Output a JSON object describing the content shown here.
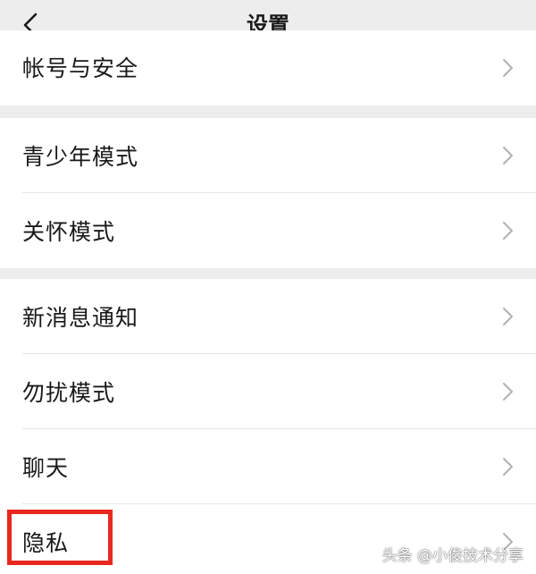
{
  "header": {
    "title": "设置"
  },
  "groups": [
    {
      "items": [
        {
          "label": "帐号与安全"
        }
      ]
    },
    {
      "items": [
        {
          "label": "青少年模式"
        },
        {
          "label": "关怀模式"
        }
      ]
    },
    {
      "items": [
        {
          "label": "新消息通知"
        },
        {
          "label": "勿扰模式"
        },
        {
          "label": "聊天"
        },
        {
          "label": "隐私"
        }
      ]
    }
  ],
  "watermark": "头条 @小俊技术分享",
  "colors": {
    "background": "#ededed",
    "card": "#ffffff",
    "highlight": "#e8281f"
  },
  "icons": {
    "back": "chevron-left-icon",
    "row_arrow": "chevron-right-icon"
  }
}
